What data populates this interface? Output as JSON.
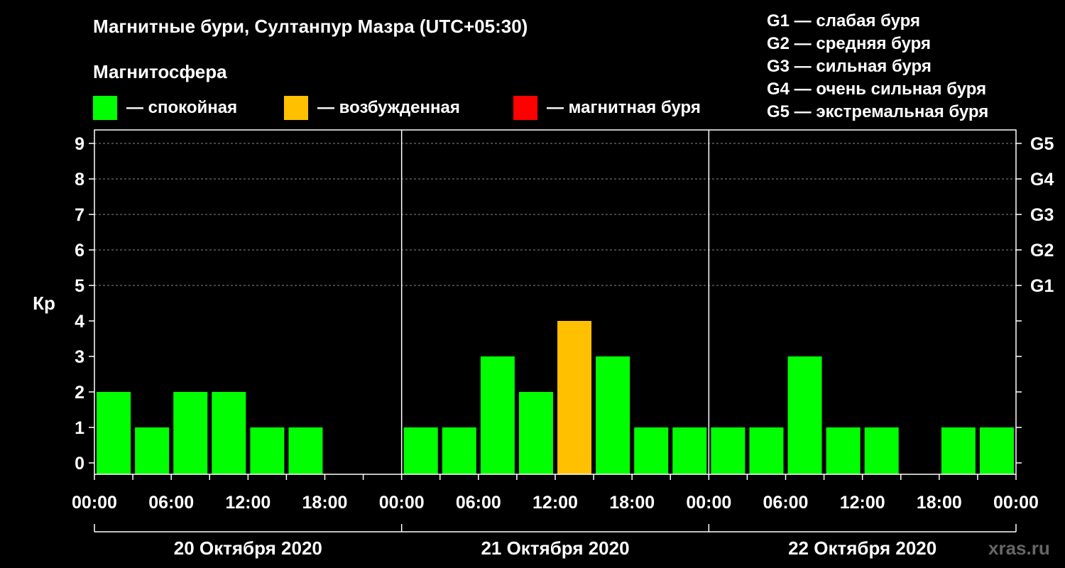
{
  "chart_data": {
    "type": "bar",
    "title": "Магнитные бури, Султанпур Мазра (UTC+05:30)",
    "subtitle": "Магнитосфера",
    "ylabel": "Кр",
    "ylim": [
      0,
      9
    ],
    "y_ticks": [
      "0",
      "1",
      "2",
      "3",
      "4",
      "5",
      "6",
      "7",
      "8",
      "9"
    ],
    "storm_ticks": [
      {
        "kp": 5,
        "label": "G1"
      },
      {
        "kp": 6,
        "label": "G2"
      },
      {
        "kp": 7,
        "label": "G3"
      },
      {
        "kp": 8,
        "label": "G4"
      },
      {
        "kp": 9,
        "label": "G5"
      }
    ],
    "x_ticks": [
      "00:00",
      "06:00",
      "12:00",
      "18:00",
      "00:00",
      "06:00",
      "12:00",
      "18:00",
      "00:00",
      "06:00",
      "12:00",
      "18:00",
      "00:00"
    ],
    "days": [
      "20 Октября 2020",
      "21 Октября 2020",
      "22 Октября 2020"
    ],
    "interval_hours": 3,
    "values": [
      2,
      1,
      2,
      2,
      1,
      1,
      0,
      0,
      1,
      1,
      3,
      2,
      4,
      3,
      1,
      1,
      1,
      1,
      3,
      1,
      1,
      0,
      1,
      1
    ],
    "bar_colors": [
      "#00ff00",
      "#00ff00",
      "#00ff00",
      "#00ff00",
      "#00ff00",
      "#00ff00",
      "#00ff00",
      "#00ff00",
      "#00ff00",
      "#00ff00",
      "#00ff00",
      "#00ff00",
      "#ffc000",
      "#00ff00",
      "#00ff00",
      "#00ff00",
      "#00ff00",
      "#00ff00",
      "#00ff00",
      "#00ff00",
      "#00ff00",
      "#00ff00",
      "#00ff00",
      "#00ff00"
    ],
    "legend": [
      {
        "label": "— спокойная",
        "color": "#00ff00"
      },
      {
        "label": "— возбужденная",
        "color": "#ffc000"
      },
      {
        "label": "— магнитная буря",
        "color": "#ff0000"
      }
    ],
    "storm_legend": [
      "G1 — слабая буря",
      "G2 — средняя буря",
      "G3 — сильная буря",
      "G4 — очень сильная буря",
      "G5 — экстремальная буря"
    ],
    "grid": true
  },
  "watermark": "xras.ru"
}
